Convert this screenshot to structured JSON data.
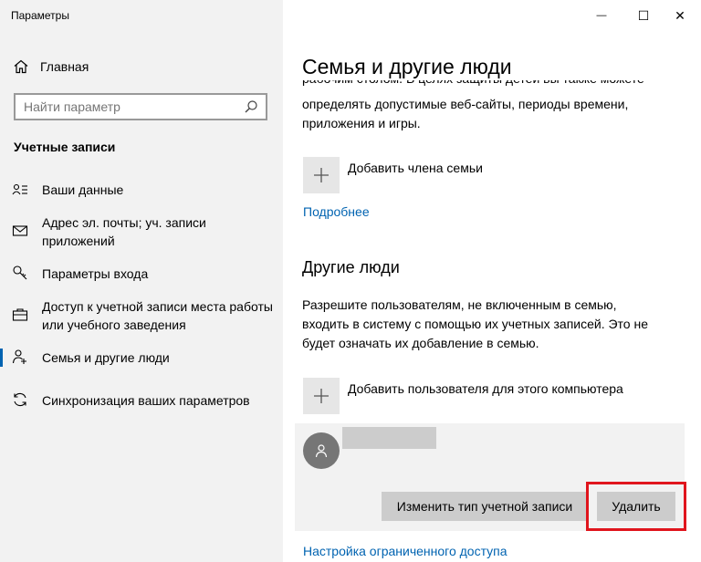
{
  "window": {
    "title": "Параметры",
    "minimize_symbol": "—",
    "maximize_symbol": "☐",
    "close_symbol": "✕"
  },
  "sidebar": {
    "home_label": "Главная",
    "search_placeholder": "Найти параметр",
    "section_title": "Учетные записи",
    "items": [
      {
        "label": "Ваши данные",
        "icon": "person-card-icon"
      },
      {
        "label": "Адрес эл. почты; уч. записи приложений",
        "icon": "mail-icon"
      },
      {
        "label": "Параметры входа",
        "icon": "key-icon"
      },
      {
        "label": "Доступ к учетной записи места работы или учебного заведения",
        "icon": "briefcase-icon"
      },
      {
        "label": "Семья и другие люди",
        "icon": "people-icon",
        "active": true
      },
      {
        "label": "Синхронизация ваших параметров",
        "icon": "sync-icon"
      }
    ]
  },
  "main": {
    "title": "Семья и другие люди",
    "cut_text": "рабочим столом. В целях защиты детей вы также можете",
    "family_text": "определять допустимые веб-сайты, периоды времени, приложения и игры.",
    "add_family_label": "Добавить члена семьи",
    "more_link": "Подробнее",
    "other_people_heading": "Другие люди",
    "other_people_text": "Разрешите пользователям, не включенным в семью, входить в систему с помощью их учетных записей. Это не будет означать их добавление в семью.",
    "add_user_label": "Добавить пользователя для этого компьютера",
    "change_type_button": "Изменить тип учетной записи",
    "delete_button": "Удалить",
    "restricted_access_link": "Настройка ограниченного доступа"
  },
  "colors": {
    "accent": "#0063b1",
    "highlight": "#e0151d",
    "sidebar_bg": "#f2f2f2"
  }
}
